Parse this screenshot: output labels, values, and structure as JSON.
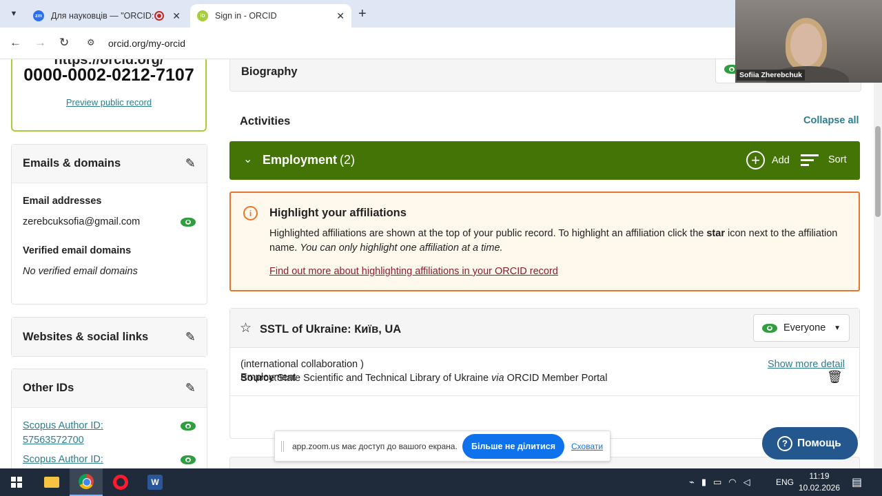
{
  "browser": {
    "tabs": [
      {
        "title": "Для науковців — \"ORCID: ",
        "favicon": "zm",
        "recording": true
      },
      {
        "title": "Sign in - ORCID",
        "favicon": "iD"
      }
    ],
    "url": "orcid.org/my-orcid"
  },
  "sidebar": {
    "orcid_url_fragment": "https://orcid.org/",
    "orcid_id": "0000-0002-0212-7107",
    "preview_link": "Preview public record",
    "emails": {
      "title": "Emails & domains",
      "addresses_label": "Email addresses",
      "email": "zerebcuksofia@gmail.com",
      "verified_label": "Verified email domains",
      "verified_value": "No verified email domains"
    },
    "websites": {
      "title": "Websites & social links"
    },
    "other_ids": {
      "title": "Other IDs",
      "items": [
        {
          "label": "Scopus Author ID:",
          "value": "57563572700"
        },
        {
          "label": "Scopus Author ID:",
          "value": ""
        }
      ]
    }
  },
  "main": {
    "biography": {
      "title": "Biography"
    },
    "activities_label": "Activities",
    "collapse_all": "Collapse all",
    "employment": {
      "title": "Employment",
      "count": "(2)",
      "add_label": "Add",
      "sort_label": "Sort"
    },
    "notice": {
      "title": "Highlight your affiliations",
      "text_part1": "Highlighted affiliations are shown at the top of your public record. To highlight an affiliation click the ",
      "text_bold": "star",
      "text_part2": " icon next to the affiliation name. ",
      "text_italic": "You can only highlight one affiliation at a time.",
      "link": "Find out more about highlighting affiliations in your ORCID record"
    },
    "affiliation": {
      "title": "SSTL of Ukraine: Київ, UA",
      "visibility": "Everyone",
      "line1": "(international collaboration )",
      "line2": "Employment",
      "show_more": "Show more detail",
      "source_label": "Source",
      "source_org": "State Scientific and Technical Library of Ukraine",
      "source_via": "via",
      "source_portal": "ORCID Member Portal"
    }
  },
  "zoom_share": {
    "message": "app.zoom.us має доступ до вашого екрана.",
    "stop_button": "Більше не ділитися",
    "hide_link": "Сховати"
  },
  "help_button": "Помощь",
  "webcam": {
    "name": "Sofiia Zherebchuk"
  },
  "taskbar": {
    "language": "ENG",
    "time": "11:19",
    "date": "10.02.2026"
  },
  "colors": {
    "employment_bar": "#447405",
    "notice_border": "#e8752a",
    "link": "#2e7d8f",
    "help_button": "#23578d",
    "zoom_blue": "#0e72ed"
  }
}
